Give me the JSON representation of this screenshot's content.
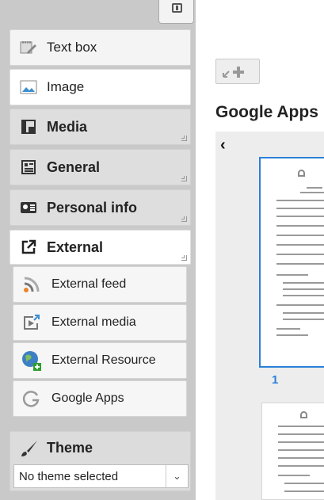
{
  "sidebar": {
    "items": [
      {
        "label": "Text box",
        "icon": "text-box-icon"
      },
      {
        "label": "Image",
        "icon": "image-icon"
      },
      {
        "label": "Media",
        "icon": "media-icon"
      },
      {
        "label": "General",
        "icon": "general-icon"
      },
      {
        "label": "Personal info",
        "icon": "personal-info-icon"
      },
      {
        "label": "External",
        "icon": "external-link-icon"
      }
    ],
    "external_items": [
      {
        "label": "External feed",
        "icon": "rss-feed-icon"
      },
      {
        "label": "External media",
        "icon": "external-media-icon"
      },
      {
        "label": "External Resource",
        "icon": "globe-icon"
      },
      {
        "label": "Google Apps",
        "icon": "google-icon"
      }
    ],
    "theme": {
      "title": "Theme",
      "selected": "No theme selected"
    }
  },
  "main": {
    "title": "Google Apps",
    "pages": [
      "1"
    ]
  },
  "colors": {
    "accent": "#2a80d8",
    "sidebar_bg": "#c9c9c9"
  }
}
